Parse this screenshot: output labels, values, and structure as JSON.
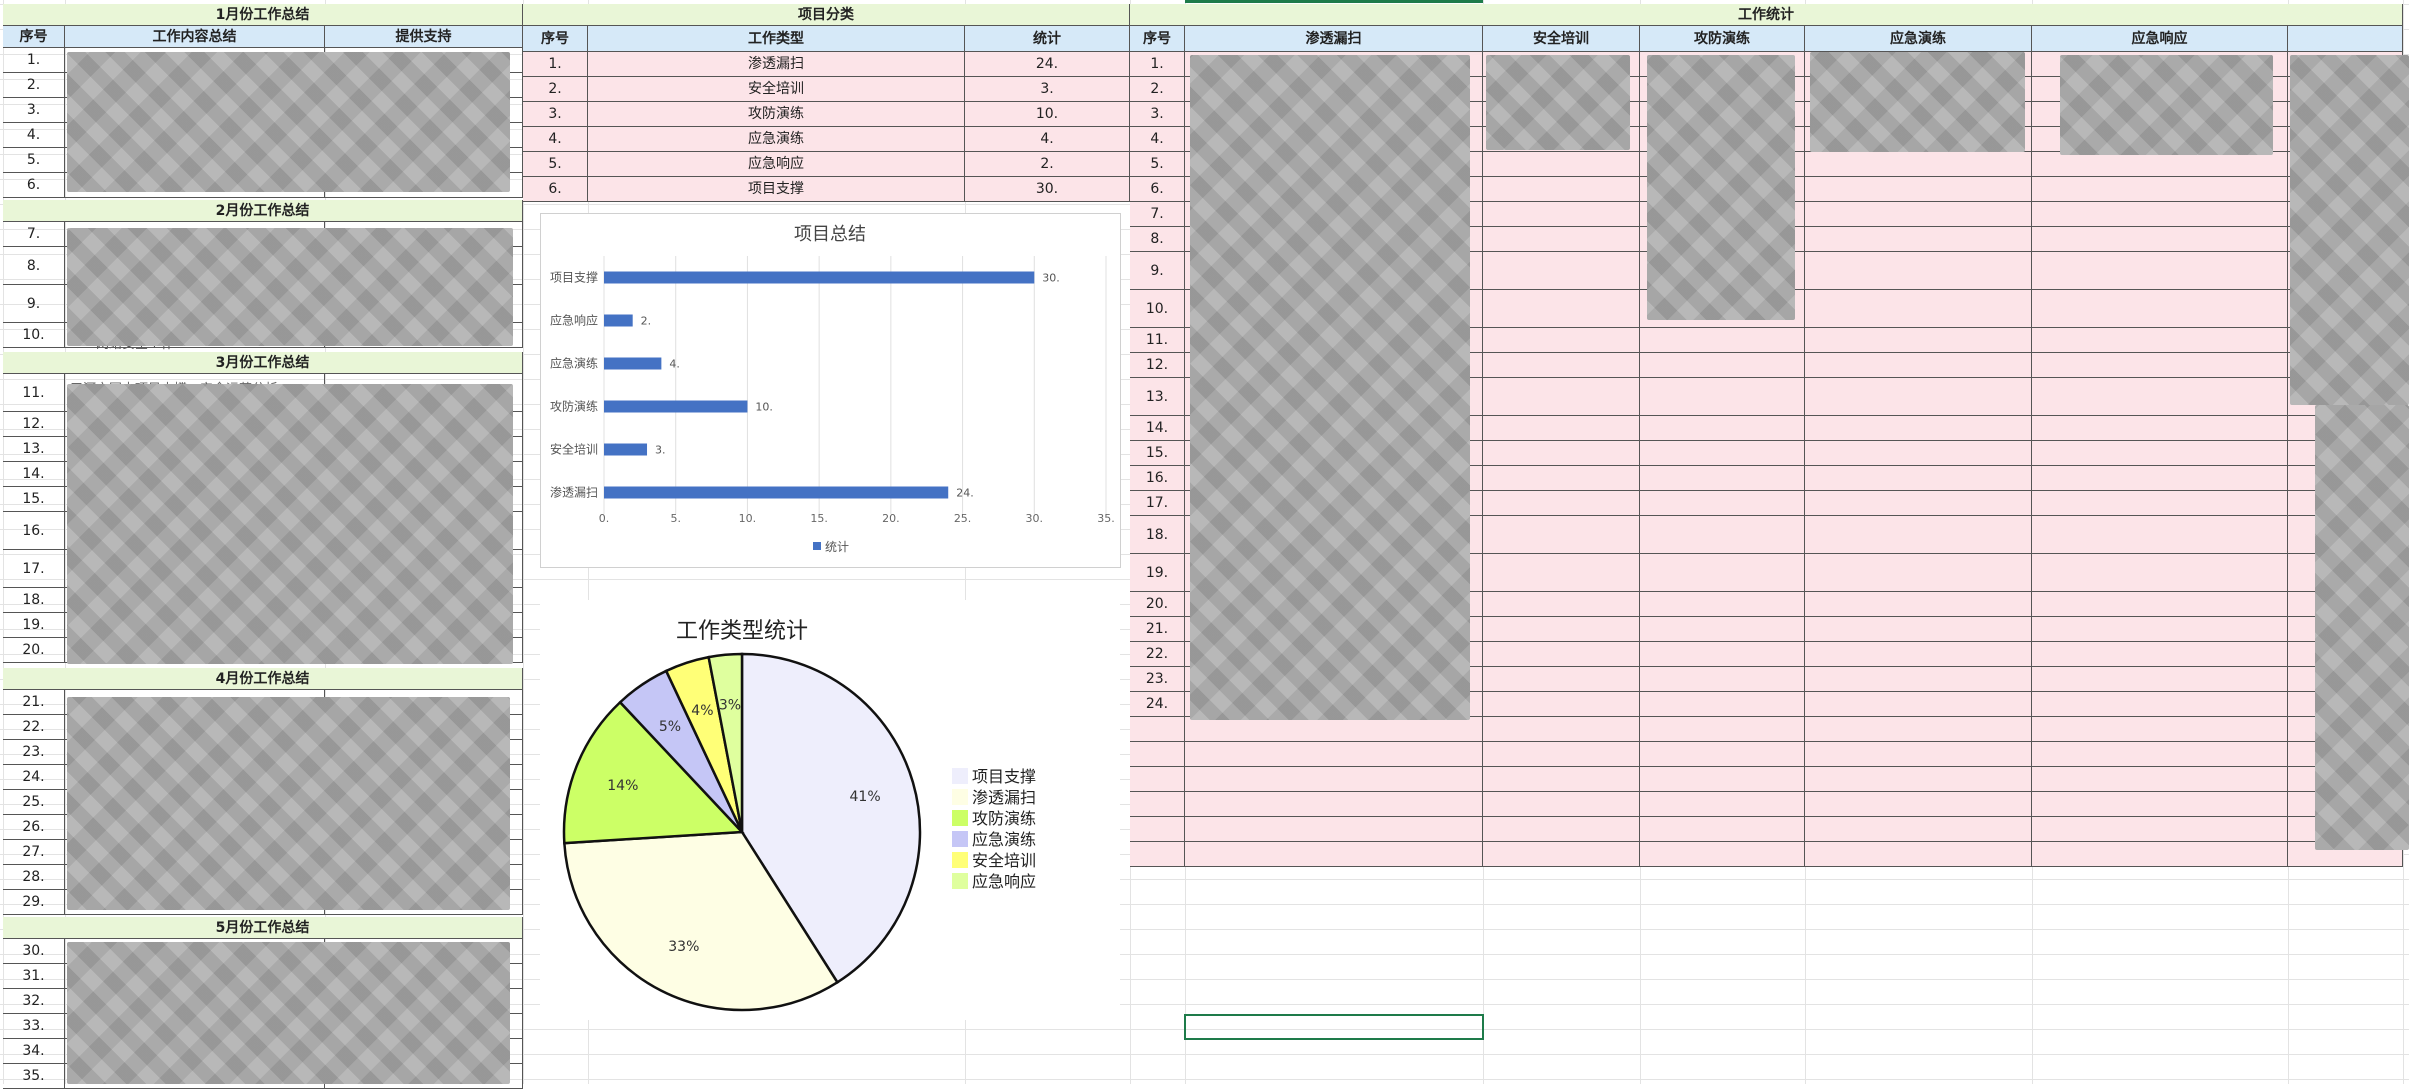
{
  "left": {
    "sections": [
      {
        "title": "1月份工作总结",
        "rows": [
          "1.",
          "2.",
          "3.",
          "4.",
          "5.",
          "6."
        ]
      },
      {
        "title": "2月份工作总结",
        "rows": [
          "7.",
          "8.",
          "9.",
          "10."
        ]
      },
      {
        "title": "3月份工作总结",
        "rows": [
          "11.",
          "12.",
          "13.",
          "14.",
          "15.",
          "16.",
          "17.",
          "18.",
          "19.",
          "20."
        ]
      },
      {
        "title": "4月份工作总结",
        "rows": [
          "21.",
          "22.",
          "23.",
          "24.",
          "25.",
          "26.",
          "27.",
          "28.",
          "29."
        ]
      },
      {
        "title": "5月份工作总结",
        "rows": [
          "30.",
          "31.",
          "32.",
          "33.",
          "34.",
          "35."
        ]
      }
    ],
    "headers": {
      "no": "序号",
      "content": "工作内容总结",
      "support": "提供支持"
    },
    "partial_text": "网络安全工作",
    "partial_text2": "三河市国中项目支撑，安全运营分析"
  },
  "middle": {
    "title": "项目分类",
    "headers": {
      "no": "序号",
      "type": "工作类型",
      "count": "统计"
    },
    "rows": [
      {
        "no": "1.",
        "type": "渗透漏扫",
        "count": "24."
      },
      {
        "no": "2.",
        "type": "安全培训",
        "count": "3."
      },
      {
        "no": "3.",
        "type": "攻防演练",
        "count": "10."
      },
      {
        "no": "4.",
        "type": "应急演练",
        "count": "4."
      },
      {
        "no": "5.",
        "type": "应急响应",
        "count": "2."
      },
      {
        "no": "6.",
        "type": "项目支撑",
        "count": "30."
      }
    ]
  },
  "right": {
    "title": "工作统计",
    "headers": {
      "no": "序号",
      "c1": "渗透漏扫",
      "c2": "安全培训",
      "c3": "攻防演练",
      "c4": "应急演练",
      "c5": "应急响应"
    },
    "rows": [
      "1.",
      "2.",
      "3.",
      "4.",
      "5.",
      "6.",
      "7.",
      "8.",
      "9.",
      "10.",
      "11.",
      "12.",
      "13.",
      "14.",
      "15.",
      "16.",
      "17.",
      "18.",
      "19.",
      "20.",
      "21.",
      "22.",
      "23.",
      "24."
    ]
  },
  "chart_data": [
    {
      "type": "bar",
      "title": "项目总结",
      "categories": [
        "渗透漏扫",
        "安全培训",
        "攻防演练",
        "应急演练",
        "应急响应",
        "项目支撑"
      ],
      "values": [
        24,
        3,
        10,
        4,
        2,
        30
      ],
      "data_labels": [
        "24.",
        "3.",
        "10.",
        "4.",
        "2.",
        "30."
      ],
      "xticks": [
        "0.",
        "5.",
        "10.",
        "15.",
        "20.",
        "25.",
        "30.",
        "35."
      ],
      "xlim": [
        0,
        35
      ],
      "legend": "统计",
      "color": "#4472c4",
      "grid": true,
      "orientation": "horizontal",
      "legend_position": "bottom"
    },
    {
      "type": "pie",
      "title": "工作类型统计",
      "slices": [
        {
          "name": "项目支撑",
          "value": 41,
          "label": "41%",
          "color": "#eeeefc"
        },
        {
          "name": "渗透漏扫",
          "value": 33,
          "label": "33%",
          "color": "#fefee4"
        },
        {
          "name": "攻防演练",
          "value": 14,
          "label": "14%",
          "color": "#ccff66"
        },
        {
          "name": "应急演练",
          "value": 5,
          "label": "5%",
          "color": "#c5c6f6"
        },
        {
          "name": "安全培训",
          "value": 4,
          "label": "4%",
          "color": "#ffff77"
        },
        {
          "name": "应急响应",
          "value": 3,
          "label": "3%",
          "color": "#dfff9e"
        }
      ],
      "legend_position": "right"
    }
  ]
}
